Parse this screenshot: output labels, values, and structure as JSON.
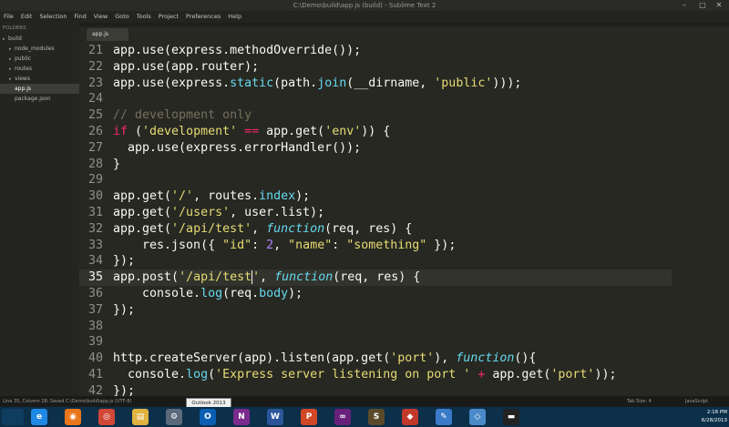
{
  "window": {
    "title": "C:\\Demo\\build\\app.js (build) - Sublime Text 2"
  },
  "menu": [
    "File",
    "Edit",
    "Selection",
    "Find",
    "View",
    "Goto",
    "Tools",
    "Project",
    "Preferences",
    "Help"
  ],
  "sidebar": {
    "header": "FOLDERS",
    "items": [
      {
        "label": "build",
        "depth": 0,
        "folder": true
      },
      {
        "label": "node_modules",
        "depth": 1,
        "folder": true
      },
      {
        "label": "public",
        "depth": 1,
        "folder": true
      },
      {
        "label": "routes",
        "depth": 1,
        "folder": true
      },
      {
        "label": "views",
        "depth": 1,
        "folder": true
      },
      {
        "label": "app.js",
        "depth": 1,
        "folder": false,
        "active": true
      },
      {
        "label": "package.json",
        "depth": 1,
        "folder": false
      }
    ]
  },
  "tab": {
    "label": "app.js"
  },
  "code": [
    {
      "n": "21",
      "t": [
        [
          "pl",
          "app.use(express.methodOverride());"
        ]
      ]
    },
    {
      "n": "22",
      "t": [
        [
          "pl",
          "app.use(app.router);"
        ]
      ]
    },
    {
      "n": "23",
      "t": [
        [
          "pl",
          "app.use(express."
        ],
        [
          "bi",
          "static"
        ],
        [
          "pl",
          "(path."
        ],
        [
          "bi",
          "join"
        ],
        [
          "pl",
          "(__dirname, "
        ],
        [
          "st",
          "'public'"
        ],
        [
          "pl",
          ")));"
        ]
      ]
    },
    {
      "n": "24",
      "t": []
    },
    {
      "n": "25",
      "t": [
        [
          "cm",
          "// development only"
        ]
      ]
    },
    {
      "n": "26",
      "t": [
        [
          "kw",
          "if"
        ],
        [
          "pl",
          " ("
        ],
        [
          "st",
          "'development'"
        ],
        [
          "pl",
          " "
        ],
        [
          "kw",
          "=="
        ],
        [
          "pl",
          " app.get("
        ],
        [
          "st",
          "'env'"
        ],
        [
          "pl",
          ")) {"
        ]
      ]
    },
    {
      "n": "27",
      "t": [
        [
          "pl",
          "  app.use(express.errorHandler());"
        ]
      ]
    },
    {
      "n": "28",
      "t": [
        [
          "pl",
          "}"
        ]
      ]
    },
    {
      "n": "29",
      "t": []
    },
    {
      "n": "30",
      "t": [
        [
          "pl",
          "app.get("
        ],
        [
          "st",
          "'/'"
        ],
        [
          "pl",
          ", routes."
        ],
        [
          "bi",
          "index"
        ],
        [
          "pl",
          ");"
        ]
      ]
    },
    {
      "n": "31",
      "t": [
        [
          "pl",
          "app.get("
        ],
        [
          "st",
          "'/users'"
        ],
        [
          "pl",
          ", user.list);"
        ]
      ]
    },
    {
      "n": "32",
      "t": [
        [
          "pl",
          "app.get("
        ],
        [
          "st",
          "'/api/test'"
        ],
        [
          "pl",
          ", "
        ],
        [
          "it",
          "function"
        ],
        [
          "pl",
          "(req, res) {"
        ]
      ]
    },
    {
      "n": "33",
      "t": [
        [
          "pl",
          "    res.json({ "
        ],
        [
          "st",
          "\"id\""
        ],
        [
          "pl",
          ": "
        ],
        [
          "nu",
          "2"
        ],
        [
          "pl",
          ", "
        ],
        [
          "st",
          "\"name\""
        ],
        [
          "pl",
          ": "
        ],
        [
          "st",
          "\"something\""
        ],
        [
          "pl",
          " });"
        ]
      ]
    },
    {
      "n": "34",
      "t": [
        [
          "pl",
          "});"
        ]
      ]
    },
    {
      "n": "35",
      "cur": true,
      "t": [
        [
          "pl",
          "app.post("
        ],
        [
          "st",
          "'/api/test"
        ],
        [
          "caret",
          ""
        ],
        [
          "st",
          "'"
        ],
        [
          "pl",
          ", "
        ],
        [
          "it",
          "function"
        ],
        [
          "pl",
          "(req, res) {"
        ]
      ]
    },
    {
      "n": "36",
      "t": [
        [
          "pl",
          "    console."
        ],
        [
          "bi",
          "log"
        ],
        [
          "pl",
          "(req."
        ],
        [
          "bi",
          "body"
        ],
        [
          "pl",
          ");"
        ]
      ]
    },
    {
      "n": "37",
      "t": [
        [
          "pl",
          "});"
        ]
      ]
    },
    {
      "n": "38",
      "t": []
    },
    {
      "n": "39",
      "t": []
    },
    {
      "n": "40",
      "t": [
        [
          "pl",
          "http.createServer(app).listen(app.get("
        ],
        [
          "st",
          "'port'"
        ],
        [
          "pl",
          "), "
        ],
        [
          "it",
          "function"
        ],
        [
          "pl",
          "(){"
        ]
      ]
    },
    {
      "n": "41",
      "t": [
        [
          "pl",
          "  console."
        ],
        [
          "bi",
          "log"
        ],
        [
          "pl",
          "("
        ],
        [
          "st",
          "'Express server listening on port '"
        ],
        [
          "pl",
          " "
        ],
        [
          "kw",
          "+"
        ],
        [
          "pl",
          " app.get("
        ],
        [
          "st",
          "'port'"
        ],
        [
          "pl",
          "));"
        ]
      ]
    },
    {
      "n": "42",
      "t": [
        [
          "pl",
          "});"
        ]
      ]
    }
  ],
  "status": {
    "left": "Line 35, Column 28; Saved C:\\Demo\\build\\app.js (UTF-8)",
    "tab_size": "Tab Size: 4",
    "syntax": "JavaScript"
  },
  "tooltip": "Outlook 2013",
  "taskbar": {
    "apps": [
      {
        "name": "ie-icon",
        "glyph": "e",
        "color": "#1e88e5"
      },
      {
        "name": "firefox-icon",
        "glyph": "◉",
        "color": "#e8771b"
      },
      {
        "name": "chrome-icon",
        "glyph": "◎",
        "color": "#d14836"
      },
      {
        "name": "explorer-icon",
        "glyph": "▤",
        "color": "#e0b341"
      },
      {
        "name": "settings-icon",
        "glyph": "⚙",
        "color": "#5a6a7a"
      },
      {
        "name": "outlook-icon",
        "glyph": "O",
        "color": "#0a5fb4"
      },
      {
        "name": "onenote-icon",
        "glyph": "N",
        "color": "#7b2a8e"
      },
      {
        "name": "word-icon",
        "glyph": "W",
        "color": "#2b579a"
      },
      {
        "name": "powerpoint-icon",
        "glyph": "P",
        "color": "#d24726"
      },
      {
        "name": "visual-studio-icon",
        "glyph": "∞",
        "color": "#68217a"
      },
      {
        "name": "sublime-icon",
        "glyph": "S",
        "color": "#5a4a2a"
      },
      {
        "name": "git-icon",
        "glyph": "◆",
        "color": "#c0392b"
      },
      {
        "name": "paint-icon",
        "glyph": "✎",
        "color": "#3a7ac9"
      },
      {
        "name": "network-icon",
        "glyph": "◇",
        "color": "#4a8ac9"
      },
      {
        "name": "console-icon",
        "glyph": "▬",
        "color": "#222"
      }
    ],
    "time": "2:18 PM",
    "date": "6/28/2013"
  }
}
